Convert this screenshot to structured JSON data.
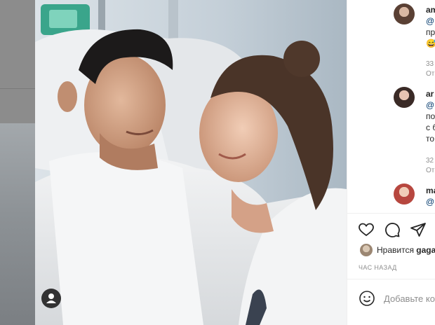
{
  "panel": {
    "comments": [
      {
        "username": "am",
        "lines": [
          "@",
          "пр"
        ],
        "emoji": "😅",
        "time": "33",
        "reply": "От"
      },
      {
        "username": "ar",
        "lines": [
          "@",
          "по",
          "с б",
          "то"
        ],
        "emoji": "",
        "time": "32",
        "reply": "От"
      },
      {
        "username": "ma",
        "lines": [
          "@"
        ],
        "emoji": "",
        "time": "",
        "reply": ""
      }
    ],
    "likes_prefix": "Нравится",
    "likes_user": "gaga",
    "timestamp": "ЧАС НАЗАД",
    "comment_placeholder": "Добавьте ко"
  },
  "icons": {
    "like": "heart-icon",
    "comment": "comment-icon",
    "share": "paper-plane-icon",
    "emoji": "smiley-icon",
    "tags": "person-tag-icon"
  },
  "colors": {
    "text": "#262626",
    "muted": "#8e8e8e",
    "divider": "#efefef"
  }
}
